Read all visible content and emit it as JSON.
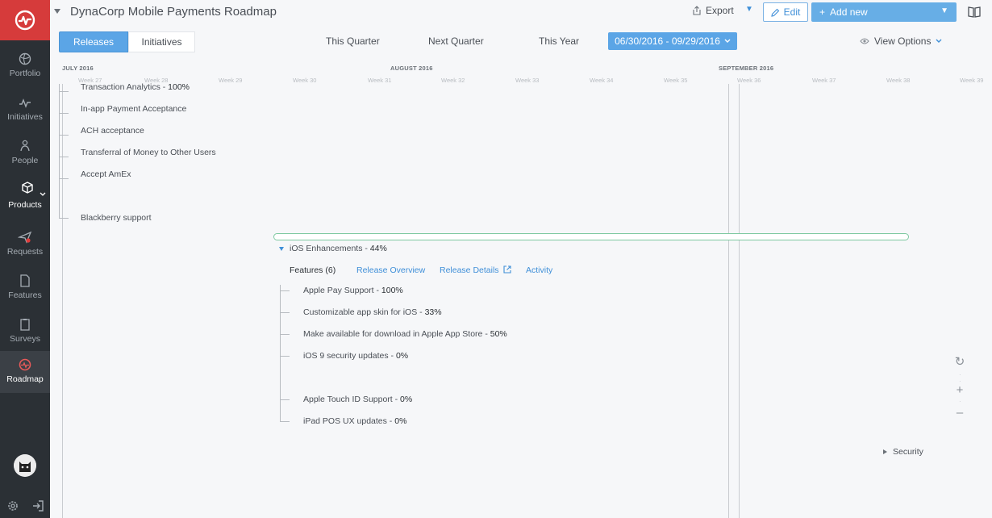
{
  "sidebar": {
    "items": [
      {
        "label": "Portfolio",
        "icon": "globe-icon"
      },
      {
        "label": "Initiatives",
        "icon": "pulse-icon"
      },
      {
        "label": "People",
        "icon": "people-icon"
      },
      {
        "label": "Products",
        "icon": "cube-icon"
      },
      {
        "label": "Requests",
        "icon": "send-icon"
      },
      {
        "label": "Features",
        "icon": "document-icon"
      },
      {
        "label": "Surveys",
        "icon": "clipboard-icon"
      },
      {
        "label": "Roadmap",
        "icon": "roadmap-icon"
      }
    ]
  },
  "header": {
    "title": "DynaCorp Mobile Payments Roadmap",
    "export_label": "Export",
    "edit_label": "Edit",
    "add_label": "Add new"
  },
  "toolbar": {
    "releases_label": "Releases",
    "initiatives_label": "Initiatives",
    "this_quarter": "This Quarter",
    "next_quarter": "Next Quarter",
    "this_year": "This Year",
    "date_range": "06/30/2016 - 09/29/2016",
    "view_options": "View Options"
  },
  "timeline": {
    "months": [
      "JULY 2016",
      "AUGUST 2016",
      "SEPTEMBER 2016"
    ],
    "weeks": [
      "Week 27",
      "Week 28",
      "Week 29",
      "Week 30",
      "Week 31",
      "Week 32",
      "Week 33",
      "Week 34",
      "Week 35",
      "Week 36",
      "Week 37",
      "Week 38",
      "Week 39"
    ]
  },
  "release1": {
    "features": [
      {
        "name": "Transaction Analytics - ",
        "pct": "100%"
      },
      {
        "name": "In-app Payment Acceptance",
        "pct": ""
      },
      {
        "name": "ACH acceptance",
        "pct": ""
      },
      {
        "name": "Transferral of Money to Other Users",
        "pct": ""
      },
      {
        "name": "Accept AmEx",
        "pct": ""
      },
      {
        "name": "Blackberry support",
        "pct": ""
      }
    ]
  },
  "release2": {
    "title": "iOS Enhancements - ",
    "title_pct": "44%",
    "tabs": {
      "features": "Features (6)",
      "overview": "Release Overview",
      "details": "Release Details",
      "activity": "Activity"
    },
    "features": [
      {
        "name": "Apple Pay Support - ",
        "pct": "100%"
      },
      {
        "name": "Customizable app skin for iOS - ",
        "pct": "33%"
      },
      {
        "name": "Make available for download in Apple App Store - ",
        "pct": "50%"
      },
      {
        "name": "iOS 9 security updates - ",
        "pct": "0%"
      },
      {
        "name": "Apple Touch ID Support - ",
        "pct": "0%"
      },
      {
        "name": "iPad POS UX updates - ",
        "pct": "0%"
      }
    ]
  },
  "release3": {
    "title": "Security"
  },
  "colors": {
    "accent": "#5ba5e6",
    "brand": "#d63b3b",
    "release_bar": "#7ec9a1"
  }
}
